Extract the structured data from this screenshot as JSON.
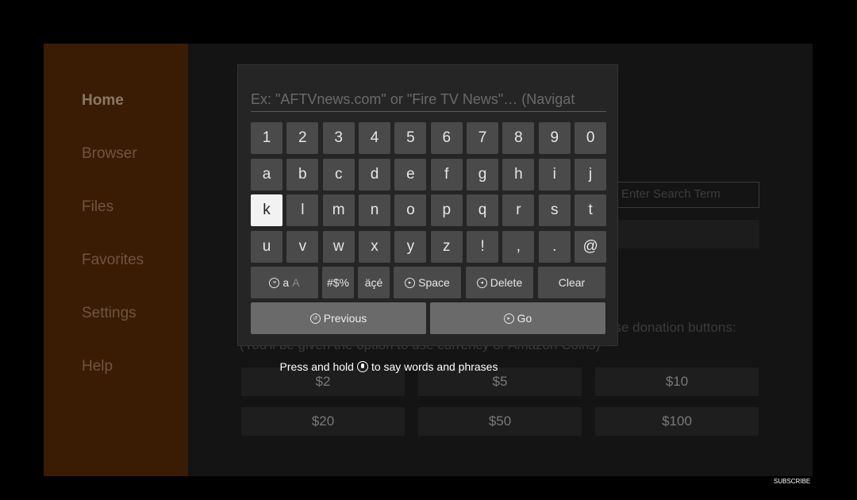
{
  "sidebar": {
    "items": [
      {
        "label": "Home",
        "active": true
      },
      {
        "label": "Browser",
        "active": false
      },
      {
        "label": "Files",
        "active": false
      },
      {
        "label": "Favorites",
        "active": false
      },
      {
        "label": "Settings",
        "active": false
      },
      {
        "label": "Help",
        "active": false
      }
    ]
  },
  "background": {
    "url_box_text": "Enter Search Term",
    "donation_text": "ase donation buttons:",
    "currency_note": "(You'll be given the option to use currency or Amazon Coins)",
    "donation_buttons": [
      "$2",
      "$5",
      "$10",
      "$20",
      "$50",
      "$100"
    ]
  },
  "keyboard": {
    "search_placeholder": "Ex: \"AFTVnews.com\" or \"Fire TV News\"… (Navigat",
    "rows": [
      [
        "1",
        "2",
        "3",
        "4",
        "5",
        "6",
        "7",
        "8",
        "9",
        "0"
      ],
      [
        "a",
        "b",
        "c",
        "d",
        "e",
        "f",
        "g",
        "h",
        "i",
        "j"
      ],
      [
        "k",
        "l",
        "m",
        "n",
        "o",
        "p",
        "q",
        "r",
        "s",
        "t"
      ],
      [
        "u",
        "v",
        "w",
        "x",
        "y",
        "z",
        "!",
        ",",
        ".",
        "@"
      ]
    ],
    "selected_key": "k",
    "function_keys": {
      "case_label_lower": "a",
      "case_label_upper": "A",
      "symbols": "#$%",
      "accents": "äçé",
      "space": "Space",
      "delete": "Delete",
      "clear": "Clear"
    },
    "previous": "Previous",
    "go": "Go",
    "icons": {
      "case": "menu-circle-icon",
      "space": "space-circle-icon",
      "delete": "rewind-circle-icon",
      "previous": "back-circle-icon",
      "go": "play-pause-circle-icon"
    }
  },
  "hint": {
    "before": "Press and hold",
    "after": "to say words and phrases"
  },
  "overlay": {
    "subscribe": "SUBSCRIBE"
  }
}
